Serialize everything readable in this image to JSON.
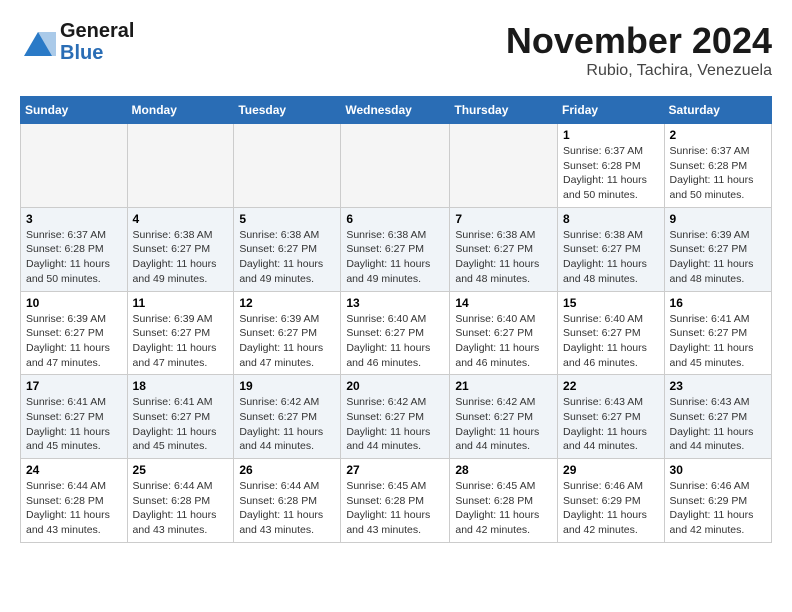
{
  "logo": {
    "line1": "General",
    "line2": "Blue"
  },
  "title": "November 2024",
  "location": "Rubio, Tachira, Venezuela",
  "weekdays": [
    "Sunday",
    "Monday",
    "Tuesday",
    "Wednesday",
    "Thursday",
    "Friday",
    "Saturday"
  ],
  "weeks": [
    [
      {
        "day": "",
        "info": ""
      },
      {
        "day": "",
        "info": ""
      },
      {
        "day": "",
        "info": ""
      },
      {
        "day": "",
        "info": ""
      },
      {
        "day": "",
        "info": ""
      },
      {
        "day": "1",
        "info": "Sunrise: 6:37 AM\nSunset: 6:28 PM\nDaylight: 11 hours and 50 minutes."
      },
      {
        "day": "2",
        "info": "Sunrise: 6:37 AM\nSunset: 6:28 PM\nDaylight: 11 hours and 50 minutes."
      }
    ],
    [
      {
        "day": "3",
        "info": "Sunrise: 6:37 AM\nSunset: 6:28 PM\nDaylight: 11 hours and 50 minutes."
      },
      {
        "day": "4",
        "info": "Sunrise: 6:38 AM\nSunset: 6:27 PM\nDaylight: 11 hours and 49 minutes."
      },
      {
        "day": "5",
        "info": "Sunrise: 6:38 AM\nSunset: 6:27 PM\nDaylight: 11 hours and 49 minutes."
      },
      {
        "day": "6",
        "info": "Sunrise: 6:38 AM\nSunset: 6:27 PM\nDaylight: 11 hours and 49 minutes."
      },
      {
        "day": "7",
        "info": "Sunrise: 6:38 AM\nSunset: 6:27 PM\nDaylight: 11 hours and 48 minutes."
      },
      {
        "day": "8",
        "info": "Sunrise: 6:38 AM\nSunset: 6:27 PM\nDaylight: 11 hours and 48 minutes."
      },
      {
        "day": "9",
        "info": "Sunrise: 6:39 AM\nSunset: 6:27 PM\nDaylight: 11 hours and 48 minutes."
      }
    ],
    [
      {
        "day": "10",
        "info": "Sunrise: 6:39 AM\nSunset: 6:27 PM\nDaylight: 11 hours and 47 minutes."
      },
      {
        "day": "11",
        "info": "Sunrise: 6:39 AM\nSunset: 6:27 PM\nDaylight: 11 hours and 47 minutes."
      },
      {
        "day": "12",
        "info": "Sunrise: 6:39 AM\nSunset: 6:27 PM\nDaylight: 11 hours and 47 minutes."
      },
      {
        "day": "13",
        "info": "Sunrise: 6:40 AM\nSunset: 6:27 PM\nDaylight: 11 hours and 46 minutes."
      },
      {
        "day": "14",
        "info": "Sunrise: 6:40 AM\nSunset: 6:27 PM\nDaylight: 11 hours and 46 minutes."
      },
      {
        "day": "15",
        "info": "Sunrise: 6:40 AM\nSunset: 6:27 PM\nDaylight: 11 hours and 46 minutes."
      },
      {
        "day": "16",
        "info": "Sunrise: 6:41 AM\nSunset: 6:27 PM\nDaylight: 11 hours and 45 minutes."
      }
    ],
    [
      {
        "day": "17",
        "info": "Sunrise: 6:41 AM\nSunset: 6:27 PM\nDaylight: 11 hours and 45 minutes."
      },
      {
        "day": "18",
        "info": "Sunrise: 6:41 AM\nSunset: 6:27 PM\nDaylight: 11 hours and 45 minutes."
      },
      {
        "day": "19",
        "info": "Sunrise: 6:42 AM\nSunset: 6:27 PM\nDaylight: 11 hours and 44 minutes."
      },
      {
        "day": "20",
        "info": "Sunrise: 6:42 AM\nSunset: 6:27 PM\nDaylight: 11 hours and 44 minutes."
      },
      {
        "day": "21",
        "info": "Sunrise: 6:42 AM\nSunset: 6:27 PM\nDaylight: 11 hours and 44 minutes."
      },
      {
        "day": "22",
        "info": "Sunrise: 6:43 AM\nSunset: 6:27 PM\nDaylight: 11 hours and 44 minutes."
      },
      {
        "day": "23",
        "info": "Sunrise: 6:43 AM\nSunset: 6:27 PM\nDaylight: 11 hours and 44 minutes."
      }
    ],
    [
      {
        "day": "24",
        "info": "Sunrise: 6:44 AM\nSunset: 6:28 PM\nDaylight: 11 hours and 43 minutes."
      },
      {
        "day": "25",
        "info": "Sunrise: 6:44 AM\nSunset: 6:28 PM\nDaylight: 11 hours and 43 minutes."
      },
      {
        "day": "26",
        "info": "Sunrise: 6:44 AM\nSunset: 6:28 PM\nDaylight: 11 hours and 43 minutes."
      },
      {
        "day": "27",
        "info": "Sunrise: 6:45 AM\nSunset: 6:28 PM\nDaylight: 11 hours and 43 minutes."
      },
      {
        "day": "28",
        "info": "Sunrise: 6:45 AM\nSunset: 6:28 PM\nDaylight: 11 hours and 42 minutes."
      },
      {
        "day": "29",
        "info": "Sunrise: 6:46 AM\nSunset: 6:29 PM\nDaylight: 11 hours and 42 minutes."
      },
      {
        "day": "30",
        "info": "Sunrise: 6:46 AM\nSunset: 6:29 PM\nDaylight: 11 hours and 42 minutes."
      }
    ]
  ]
}
